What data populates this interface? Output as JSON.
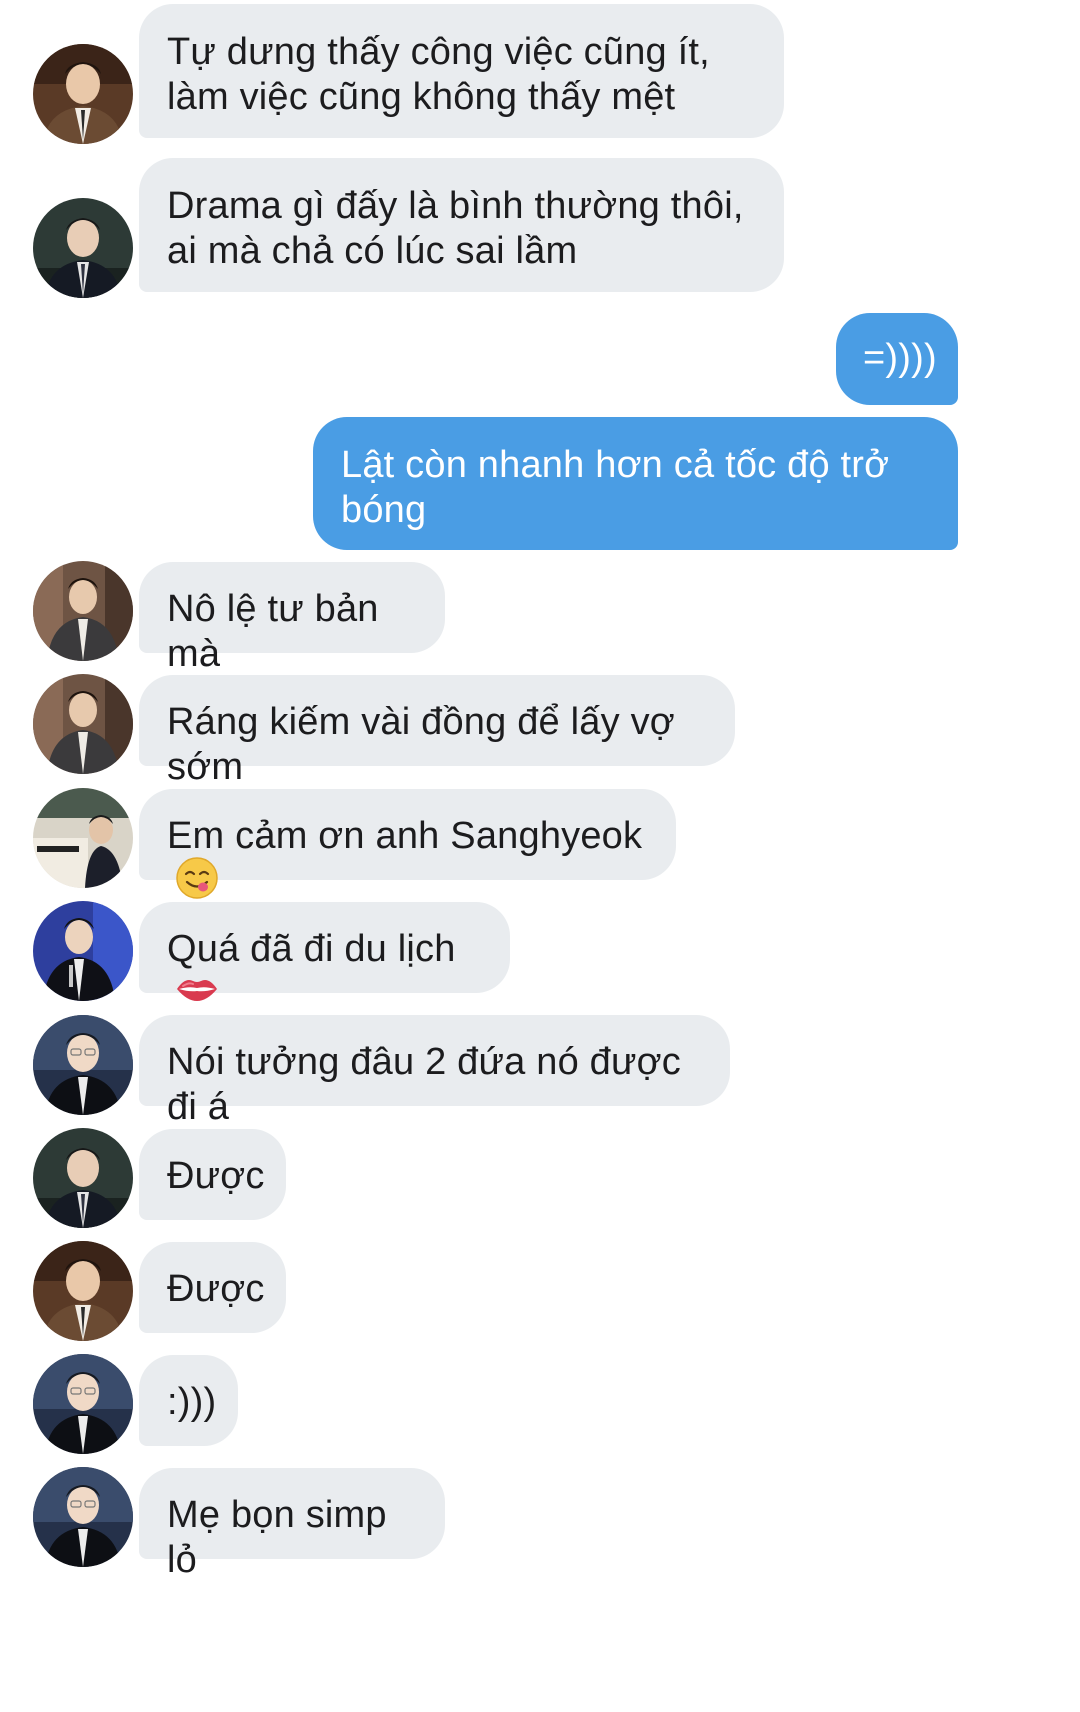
{
  "conversation": {
    "messages": [
      {
        "sender": "contact",
        "avatar": "avatar-brown-vest",
        "text": "Tự dưng thấy công việc cũng ít, làm việc cũng không thấy mệt"
      },
      {
        "sender": "contact",
        "avatar": "avatar-dark-suit",
        "text": "Drama gì đấy là bình thường thôi, ai mà chả có lúc sai lầm"
      },
      {
        "sender": "me",
        "text": "=))))"
      },
      {
        "sender": "me",
        "text": "Lật còn nhanh hơn cả tốc độ trở bóng"
      },
      {
        "sender": "contact",
        "avatar": "avatar-grey-suit",
        "text": "Nô lệ tư bản mà"
      },
      {
        "sender": "contact",
        "avatar": "avatar-grey-suit",
        "text": "Ráng kiếm vài đồng để lấy vợ sớm"
      },
      {
        "sender": "contact",
        "avatar": "avatar-piano-room",
        "text": "Em cảm ơn anh Sanghyeok",
        "emoji": "face-savoring-food-emoji"
      },
      {
        "sender": "contact",
        "avatar": "avatar-blue-backdrop",
        "text": "Quá đã đi du lịch",
        "emoji": "lips-emoji"
      },
      {
        "sender": "contact",
        "avatar": "avatar-navy-portrait",
        "text": "Nói tưởng đâu 2 đứa nó được đi á"
      },
      {
        "sender": "contact",
        "avatar": "avatar-dark-suit",
        "text": "Được"
      },
      {
        "sender": "contact",
        "avatar": "avatar-brown-vest",
        "text": "Được"
      },
      {
        "sender": "contact",
        "avatar": "avatar-navy-portrait",
        "text": ":)))"
      },
      {
        "sender": "contact",
        "avatar": "avatar-navy-portrait",
        "text": "Mẹ bọn simp lỏ"
      }
    ]
  },
  "colors": {
    "incoming_bubble": "#e9ecef",
    "outgoing_bubble": "#4a9de4",
    "incoming_text": "#1c1c1e",
    "outgoing_text": "#ffffff",
    "background": "#ffffff"
  }
}
